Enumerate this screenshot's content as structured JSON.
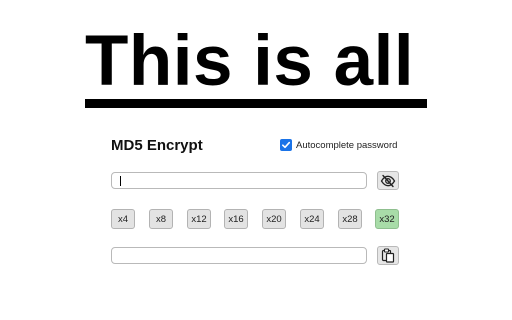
{
  "headline": {
    "text": "This is all"
  },
  "panel": {
    "title": "MD5 Encrypt",
    "autocomplete": {
      "label": "Autocomplete password",
      "checked": true
    },
    "password_input": {
      "value": ""
    },
    "output_field": {
      "value": ""
    },
    "multipliers": [
      {
        "label": "x4",
        "active": false
      },
      {
        "label": "x8",
        "active": false
      },
      {
        "label": "x12",
        "active": false
      },
      {
        "label": "x16",
        "active": false
      },
      {
        "label": "x20",
        "active": false
      },
      {
        "label": "x24",
        "active": false
      },
      {
        "label": "x28",
        "active": false
      },
      {
        "label": "x32",
        "active": true
      }
    ],
    "icons": {
      "toggle_visibility": "eye-slash-icon",
      "copy": "clipboard-icon"
    }
  },
  "colors": {
    "checkbox_accent": "#1a73e8",
    "active_multiplier": "#a8dca8",
    "button_bg": "#e3e3e3"
  }
}
